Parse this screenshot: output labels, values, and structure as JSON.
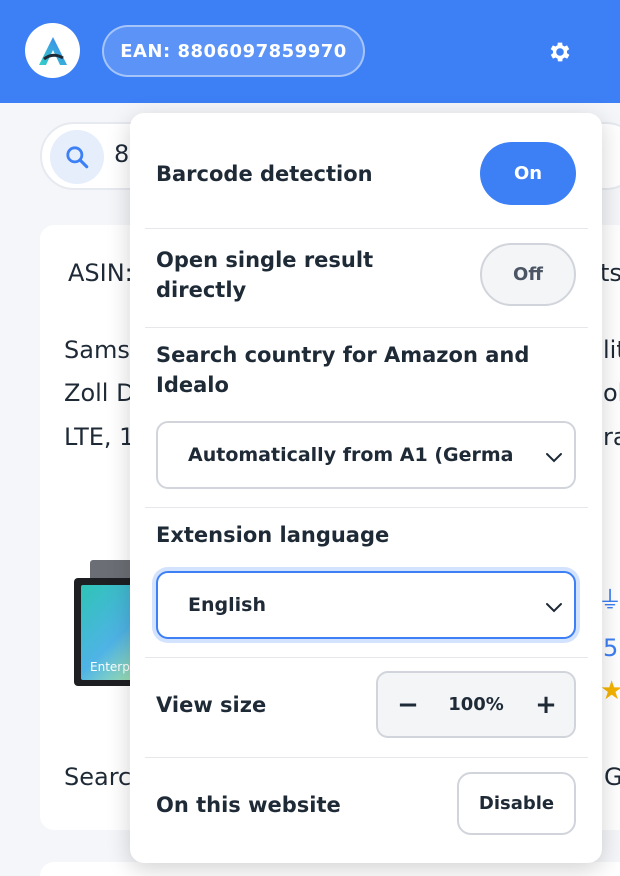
{
  "header": {
    "logo_icon": "app-logo-icon",
    "ean_label": "EAN: 8806097859970",
    "settings_icon": "gear-icon",
    "accent_color": "#3d7ff5"
  },
  "background": {
    "search_icon": "search-icon",
    "search_value_fragment": "8",
    "card": {
      "asin_fragment": "ASIN:",
      "right_fragment_1": "ts",
      "title_line_1": "Sams",
      "title_line_2": "Zoll D",
      "title_line_3": "LTE, 1",
      "right_line_1": "lit",
      "right_line_2": "oll",
      "right_line_3": "ra",
      "tablet_label": "Enterp",
      "right_number": "5",
      "search_fragment": "Searc",
      "right_bottom_fragment": "G"
    }
  },
  "settings": {
    "barcode_detection": {
      "label": "Barcode detection",
      "button": "On"
    },
    "open_single_result": {
      "label_line_1": "Open single result",
      "label_line_2": "directly",
      "button": "Off"
    },
    "search_country": {
      "label_line_1": "Search country for Amazon and",
      "label_line_2": "Idealo",
      "selected": "Automatically from A1 (Germa"
    },
    "extension_language": {
      "label": "Extension language",
      "selected": "English"
    },
    "view_size": {
      "label": "View size",
      "minus": "−",
      "value": "100%",
      "plus": "+"
    },
    "on_this_website": {
      "label": "On this website",
      "button": "Disable"
    }
  }
}
